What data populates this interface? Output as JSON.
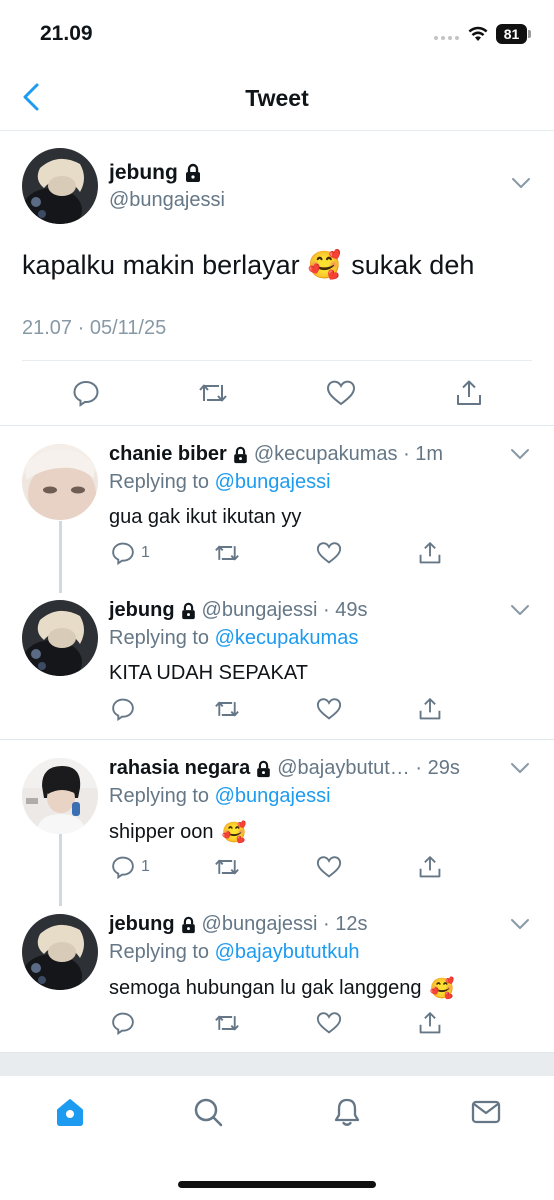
{
  "status_bar": {
    "time": "21.09",
    "battery": "81"
  },
  "header": {
    "title": "Tweet",
    "back_icon": "chevron-left-icon"
  },
  "main_tweet": {
    "display_name": "jebung",
    "handle": "@bungajessi",
    "text_before": "kapalku makin berlayar",
    "emoji": "🥰",
    "text_after": "sukak deh",
    "time": "21.07",
    "date": "05/11/25",
    "meta_separator": "·",
    "actions": [
      "reply-icon",
      "retweet-icon",
      "like-icon",
      "share-icon"
    ]
  },
  "replies": [
    {
      "display_name": "chanie biber",
      "handle": "@kecupakumas",
      "time": "1m",
      "replying_label": "Replying to",
      "replying_to": "@bungajessi",
      "text": "gua gak ikut ikutan yy",
      "emoji": "",
      "reply_count": "1"
    },
    {
      "display_name": "jebung",
      "handle": "@bungajessi",
      "time": "49s",
      "replying_label": "Replying to",
      "replying_to": "@kecupakumas",
      "text": "KITA UDAH SEPAKAT",
      "emoji": "",
      "reply_count": ""
    },
    {
      "display_name": "rahasia negara",
      "handle": "@bajaybutut…",
      "time": "29s",
      "replying_label": "Replying to",
      "replying_to": "@bungajessi",
      "text": "shipper oon",
      "emoji": "🥰",
      "reply_count": "1"
    },
    {
      "display_name": "jebung",
      "handle": "@bungajessi",
      "time": "12s",
      "replying_label": "Replying to",
      "replying_to": "@bajaybututkuh",
      "text": "semoga hubungan lu gak langgeng",
      "emoji": "🥰",
      "reply_count": ""
    }
  ],
  "tab_bar": {
    "tabs": [
      "home-icon",
      "search-icon",
      "notifications-icon",
      "messages-icon"
    ]
  },
  "colors": {
    "accent": "#1d9bf0",
    "secondary_text": "#657786",
    "divider": "#e6ecf0"
  }
}
